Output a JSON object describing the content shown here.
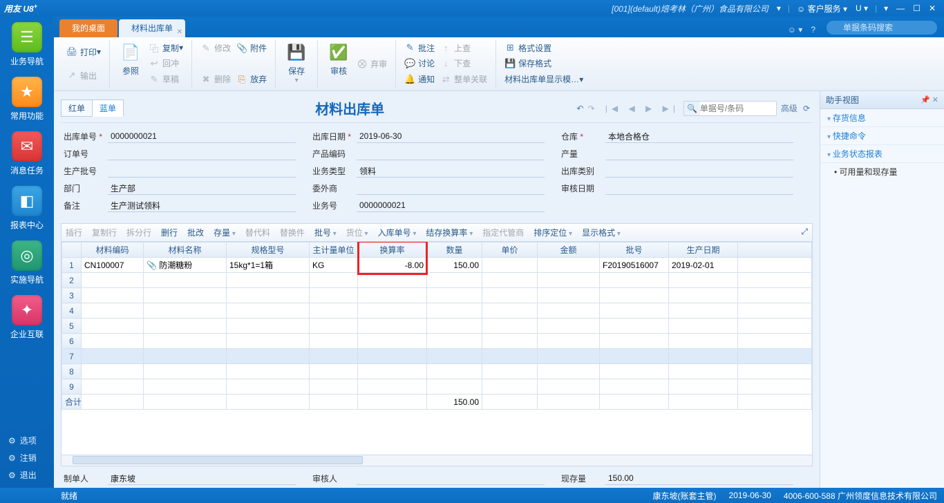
{
  "title": {
    "logo": "用友 U8",
    "company": "[001](default)焙考林（广州）食品有限公司",
    "service": "客户服务"
  },
  "leftrail": {
    "items": [
      {
        "label": "业务导航"
      },
      {
        "label": "常用功能"
      },
      {
        "label": "消息任务"
      },
      {
        "label": "报表中心"
      },
      {
        "label": "实施导航"
      },
      {
        "label": "企业互联"
      }
    ],
    "bottom": [
      {
        "label": "选项"
      },
      {
        "label": "注销"
      },
      {
        "label": "退出"
      }
    ]
  },
  "tabs": {
    "t1": "我的桌面",
    "t2": "材料出库单"
  },
  "search_placeholder": "单据条码搜索",
  "ribbon": {
    "print": "打印",
    "output": "输出",
    "ref": "参照",
    "copy": "复制",
    "reverse": "回冲",
    "draft": "草稿",
    "edit": "修改",
    "attach": "附件",
    "delete": "删除",
    "abandon": "放弃",
    "save": "保存",
    "audit": "审核",
    "abort": "弃审",
    "batch": "批注",
    "discuss": "讨论",
    "notify": "通知",
    "up": "上查",
    "down": "下查",
    "linkrel": "整单关联",
    "format": "格式设置",
    "saveformat": "保存格式",
    "displaytpl": "材料出库单显示模…"
  },
  "doc": {
    "red": "红单",
    "blue": "蓝单",
    "title": "材料出库单",
    "search_placeholder": "单据号/条码",
    "advanced": "高级"
  },
  "form": {
    "labels": {
      "docno": "出库单号",
      "docdate": "出库日期",
      "wh": "仓库",
      "order": "订单号",
      "prodcode": "产品编码",
      "qty": "产量",
      "batch": "生产批号",
      "biztype": "业务类型",
      "outtype": "出库类别",
      "dept": "部门",
      "outsource": "委外商",
      "auditdate": "审核日期",
      "memo": "备注",
      "bizno": "业务号"
    },
    "values": {
      "docno": "0000000021",
      "docdate": "2019-06-30",
      "wh": "本地合格仓",
      "order": "",
      "prodcode": "",
      "qty": "",
      "batch": "",
      "biztype": "领料",
      "outtype": "",
      "dept": "生产部",
      "outsource": "",
      "auditdate": "",
      "memo": "生产测试领料",
      "bizno": "0000000021"
    }
  },
  "gridtoolbar": [
    "插行",
    "复制行",
    "拆分行",
    "删行",
    "批改",
    "存量",
    "替代料",
    "替换件",
    "批号",
    "货位",
    "入库单号",
    "结存换算率",
    "指定代管商",
    "排序定位",
    "显示格式"
  ],
  "grid": {
    "cols": [
      "",
      "材料编码",
      "材料名称",
      "规格型号",
      "主计量单位",
      "换算率",
      "数量",
      "单价",
      "金额",
      "批号",
      "生产日期",
      ""
    ],
    "row1": {
      "code": "CN100007",
      "name": "防潮糖粉",
      "spec": "15kg*1=1箱",
      "uom": "KG",
      "rate": "-8.00",
      "qty": "150.00",
      "price": "",
      "amount": "",
      "batch": "F20190516007",
      "pdate": "2019-02-01"
    },
    "total_label": "合计",
    "total_qty": "150.00"
  },
  "footer": {
    "maker_l": "制单人",
    "maker_v": "康东坡",
    "auditor_l": "审核人",
    "stock_l": "现存量",
    "stock_v": "150.00"
  },
  "assist": {
    "title": "助手视图",
    "s1": "存货信息",
    "s2": "快捷命令",
    "s3": "业务状态报表",
    "i1": "可用量和现存量"
  },
  "status": {
    "ready": "就绪",
    "user": "康东坡(账套主管)",
    "date": "2019-06-30",
    "phone": "4006-600-588 广州领度信息技术有限公司"
  }
}
